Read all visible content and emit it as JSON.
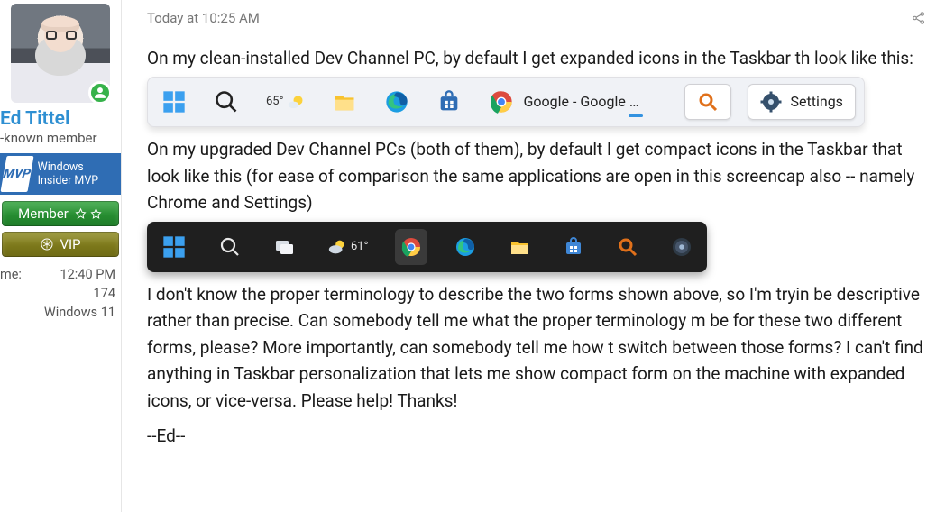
{
  "sidebar": {
    "user_name": "Ed Tittel",
    "user_rank": "-known member",
    "mvp_logo": "MVP",
    "mvp_text": "Windows Insider MVP",
    "ribbon_member": "Member",
    "ribbon_vip": "VIP",
    "meta": {
      "time_label": "me:",
      "time_value": "12:40 PM",
      "posts_label": "",
      "posts_value": "174",
      "os_label": "",
      "os_value": "Windows 11"
    }
  },
  "post": {
    "timestamp": "Today at 10:25 AM",
    "p1": "On my clean-installed Dev Channel PC, by default I get expanded icons in the Taskbar th look like this:",
    "p2": "On my upgraded Dev Channel PCs (both of them), by default I get compact icons in the Taskbar that look like this (for ease of comparison the same applications are open in this screencap also -- namely Chrome and Settings)",
    "p3": "I don't know the proper terminology to describe the two forms shown above, so I'm tryin be descriptive rather than precise. Can somebody tell me what the proper terminology m be for these two different forms, please? More importantly, can somebody tell me how t switch between those forms? I can't find anything in Taskbar personalization that lets me show compact form on the machine with expanded icons, or vice-versa. Please help! Thanks!",
    "sig": "--Ed--"
  },
  "taskbar_light": {
    "temp": "65°",
    "chrome_label": "Google - Google …",
    "settings_label": "Settings"
  },
  "taskbar_dark": {
    "temp": "61°"
  }
}
